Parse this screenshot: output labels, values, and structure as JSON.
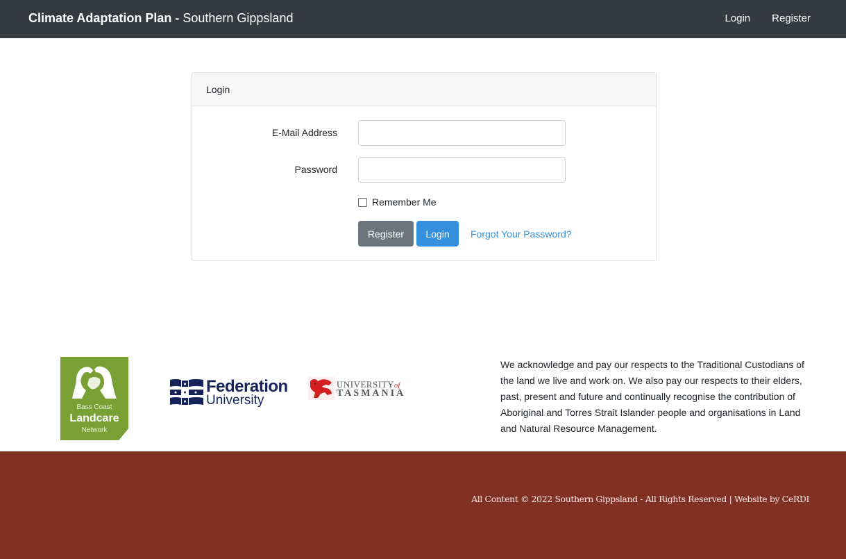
{
  "navbar": {
    "brand_bold": "Climate Adaptation Plan",
    "brand_separator": " - ",
    "brand_regular": "Southern Gippsland",
    "links": [
      {
        "label": "Login"
      },
      {
        "label": "Register"
      }
    ]
  },
  "login_card": {
    "header": "Login",
    "email": {
      "label": "E-Mail Address",
      "value": "",
      "placeholder": ""
    },
    "password": {
      "label": "Password",
      "value": "",
      "placeholder": ""
    },
    "remember_me": {
      "label": "Remember Me",
      "checked": false
    },
    "register_button": "Register",
    "login_button": "Login",
    "forgot_link": "Forgot Your Password?"
  },
  "partners": {
    "landcare": {
      "line1": "Bass Coast",
      "line2": "Landcare",
      "line3": "Network"
    },
    "federation": {
      "line1": "Federation",
      "line2": "University"
    },
    "utas": {
      "line1": "UNIVERSITY",
      "of": "of",
      "line2": "TASMANIA"
    }
  },
  "acknowledgement": "We acknowledge and pay our respects to the Traditional Custodians of the land we live and work on. We also pay our respects to their elders, past, present and future and continually recognise the contribution of Aboriginal and Torres Strait Islander people and organisations in Land and Natural Resource Management.",
  "footer": {
    "copyright": "All Content © 2022 Southern Gippsland - All Rights Reserved | Website by CeRDI"
  },
  "colors": {
    "navbar": "#343a40",
    "primary": "#3490dc",
    "secondary": "#6c757d",
    "footer": "#813124",
    "landcare_green": "#78a034",
    "federation_navy": "#15235a"
  }
}
